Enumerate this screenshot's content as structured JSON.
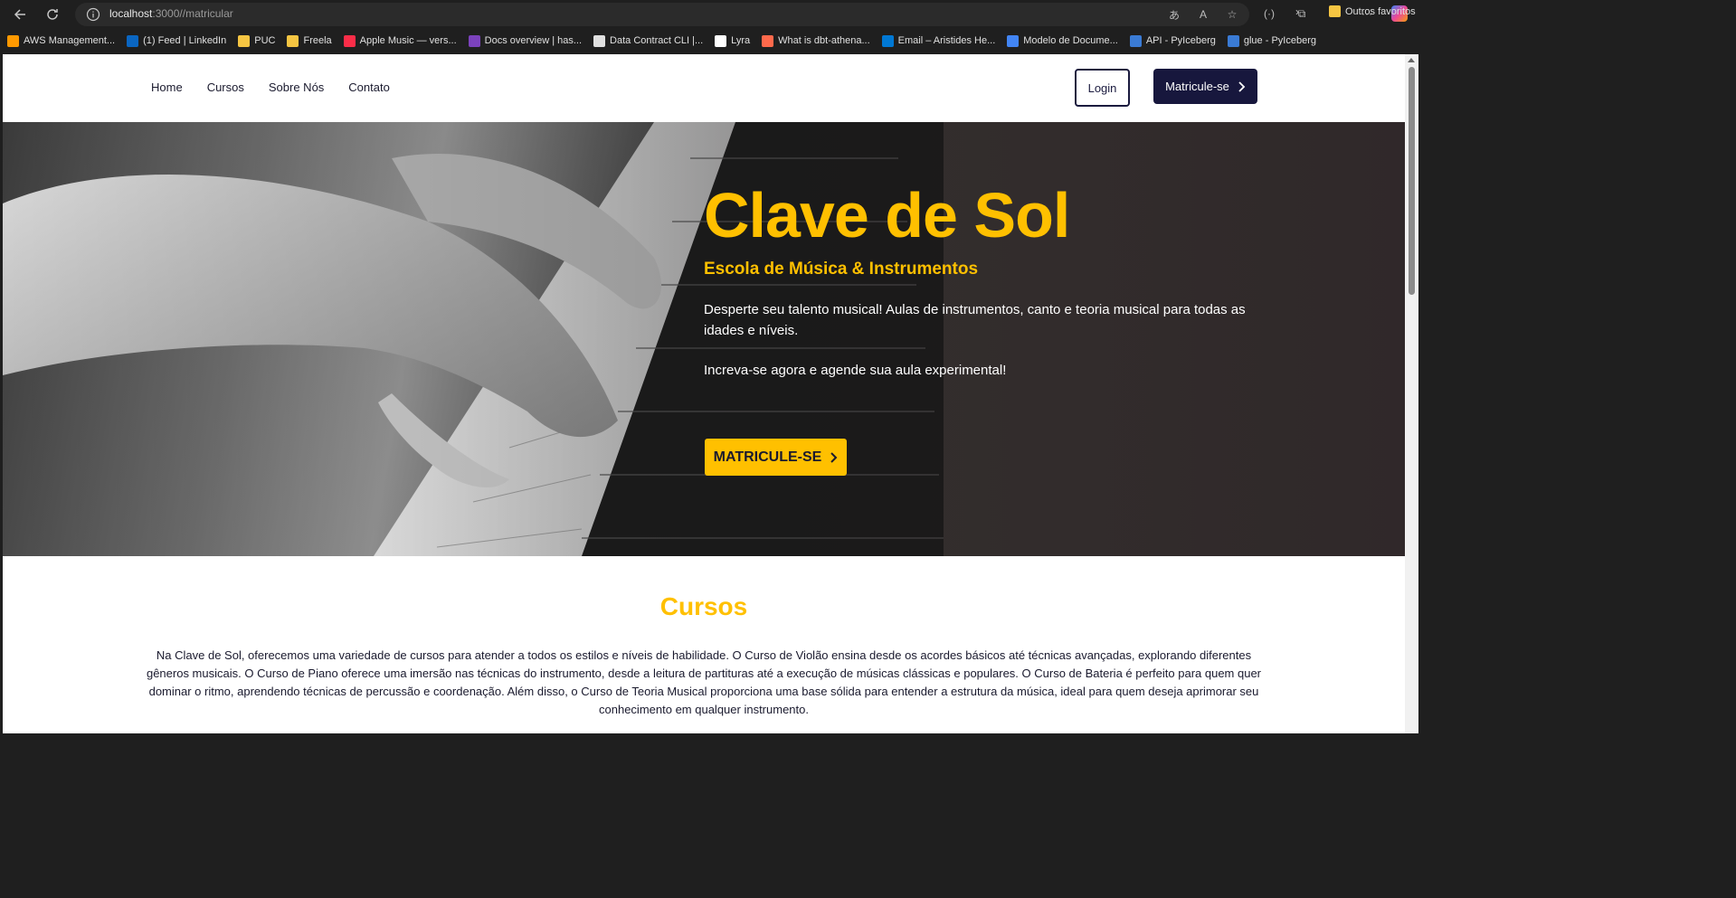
{
  "browser": {
    "url_host": "localhost",
    "url_rest": ":3000//matricular",
    "bookmarks": [
      {
        "label": "AWS Management...",
        "color": "#ff9900"
      },
      {
        "label": "(1) Feed | LinkedIn",
        "color": "#0a66c2"
      },
      {
        "label": "PUC",
        "color": "#f5c542"
      },
      {
        "label": "Freela",
        "color": "#f5c542"
      },
      {
        "label": "Apple Music — vers...",
        "color": "#fa2d48"
      },
      {
        "label": "Docs overview | has...",
        "color": "#7b42bc"
      },
      {
        "label": "Data Contract CLI |...",
        "color": "#e0e0e0"
      },
      {
        "label": "Lyra",
        "color": "#ffffff"
      },
      {
        "label": "What is dbt-athena...",
        "color": "#ff694b"
      },
      {
        "label": "Email – Aristides He...",
        "color": "#0078d4"
      },
      {
        "label": "Modelo de Docume...",
        "color": "#4285f4"
      },
      {
        "label": "API - PyIceberg",
        "color": "#3a7bd5"
      },
      {
        "label": "glue - PyIceberg",
        "color": "#3a7bd5"
      }
    ],
    "other_favorites": "Outros favoritos"
  },
  "header": {
    "nav": [
      "Home",
      "Cursos",
      "Sobre Nós",
      "Contato"
    ],
    "login_label": "Login",
    "enroll_label": "Matricule-se"
  },
  "hero": {
    "title": "Clave de Sol",
    "subtitle": "Escola de Música & Instrumentos",
    "text": "Desperte seu talento musical! Aulas de instrumentos, canto e teoria musical para todas as idades e níveis.",
    "text2": "Increva-se agora e agende sua aula experimental!",
    "cta_label": "MATRICULE-SE"
  },
  "cursos": {
    "title": "Cursos",
    "text": "Na Clave de Sol, oferecemos uma variedade de cursos para atender a todos os estilos e níveis de habilidade. O Curso de Violão ensina desde os acordes básicos até técnicas avançadas, explorando diferentes gêneros musicais. O Curso de Piano oferece uma imersão nas técnicas do instrumento, desde a leitura de partituras até a execução de músicas clássicas e populares. O Curso de Bateria é perfeito para quem quer dominar o ritmo, aprendendo técnicas de percussão e coordenação. Além disso, o Curso de Teoria Musical proporciona uma base sólida para entender a estrutura da música, ideal para quem deseja aprimorar seu conhecimento em qualquer instrumento."
  },
  "colors": {
    "accent": "#ffc000",
    "navy": "#17173d"
  }
}
